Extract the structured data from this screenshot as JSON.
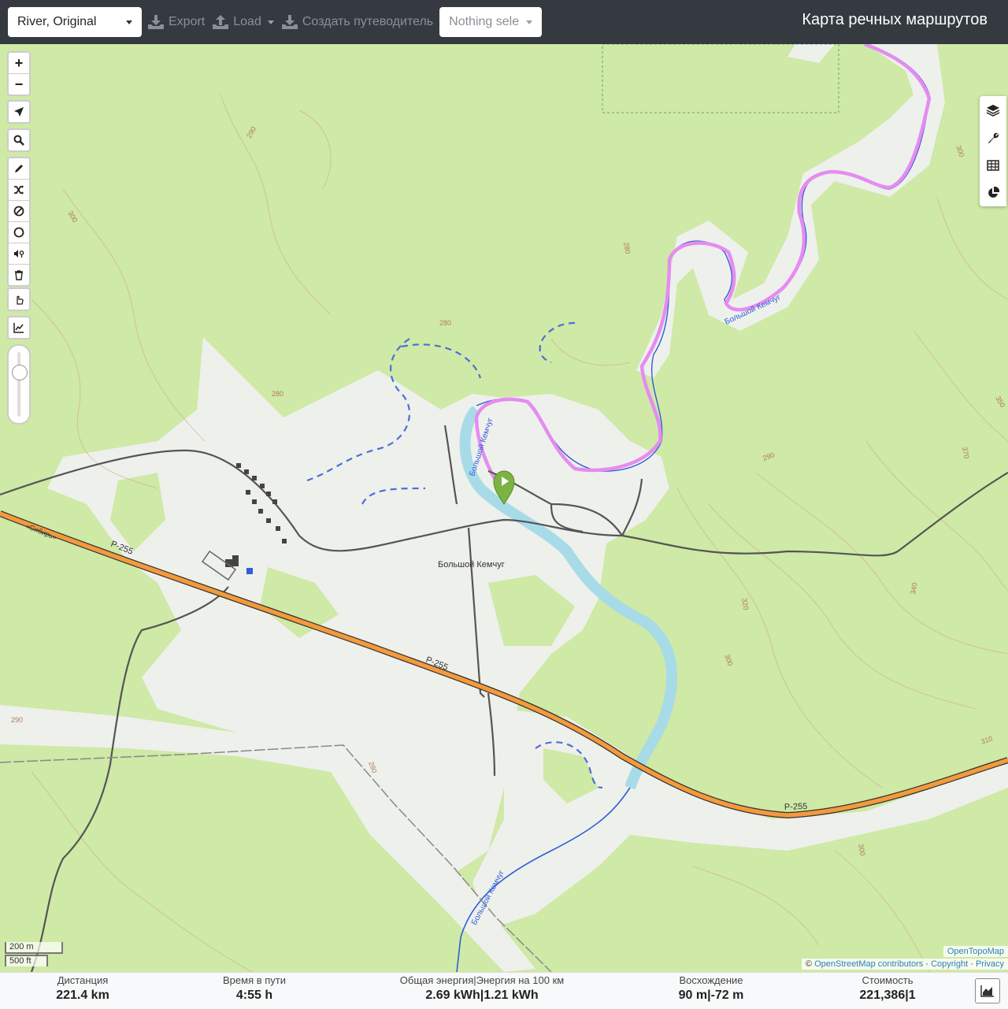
{
  "topbar": {
    "profile_select": "River, Original",
    "export_label": "Export",
    "load_label": "Load",
    "guide_label": "Создать путеводитель",
    "nothing_select": "Nothing sele",
    "title": "Карта речных маршрутов"
  },
  "map": {
    "map_labels": {
      "village": "Большой Кемчуг",
      "river_a": "Большой Кемчуг",
      "river_b": "Большой Кемчуг",
      "river_c": "Большой Кемчуг",
      "road_1": "Р-255",
      "road_2": "Р-255",
      "road_3": "Р-255",
      "highway_name": "«Сибирь»",
      "c280a": "280",
      "c280b": "280",
      "c280c": "280",
      "c290a": "290",
      "c290b": "290",
      "c290c": "290",
      "c300a": "300",
      "c300b": "300",
      "c300c": "300",
      "c300d": "300",
      "c310": "310",
      "c320": "320",
      "c340": "340",
      "c350": "350",
      "c370": "370"
    },
    "controls": {
      "zoom_in": "+",
      "zoom_out": "−"
    },
    "scale": {
      "metric": "200 m",
      "imperial": "500 ft"
    },
    "attribution": {
      "copy": "©",
      "osm": "OpenStreetMap contributors",
      "sep1": "·",
      "copyright": "Copyright",
      "sep2": "·",
      "privacy": "Privacy",
      "layer": "OpenTopoMap"
    },
    "colors": {
      "forest": "#cfe9a6",
      "clearing": "#eef0ec",
      "water": "#a8dbe8",
      "route": "#e58cf0",
      "highway": "#f39a3c",
      "marker": "#7cb342"
    }
  },
  "stats": {
    "distance_label": "Дистанция",
    "distance_value": "221.4 km",
    "time_label": "Время в пути",
    "time_value": "4:55 h",
    "energy_label": "Общая энергия|Энергия на 100 км",
    "energy_value": "2.69 kWh|1.21 kWh",
    "ascent_label": "Восхождение",
    "ascent_value": "90 m|-72 m",
    "cost_label": "Стоимость",
    "cost_value": "221,386|1"
  }
}
